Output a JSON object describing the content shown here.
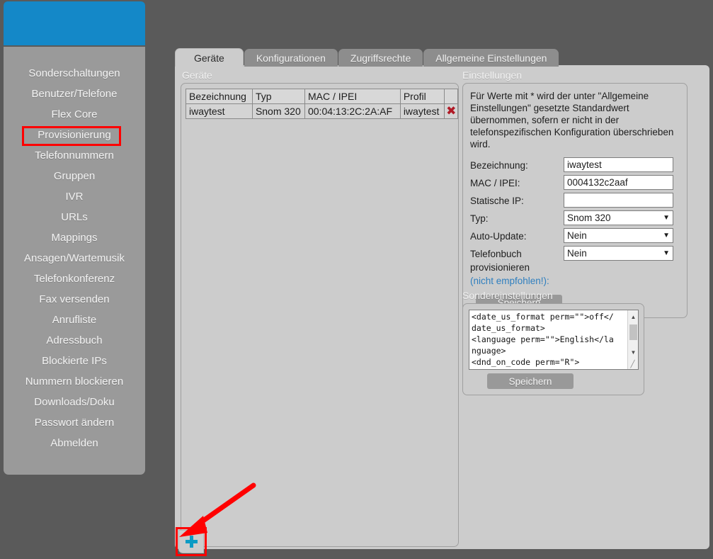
{
  "sidebar": {
    "items": [
      {
        "label": "Sonderschaltungen",
        "highlighted": false
      },
      {
        "label": "Benutzer/Telefone",
        "highlighted": false
      },
      {
        "label": "Flex Core",
        "highlighted": false
      },
      {
        "label": "Provisionierung",
        "highlighted": true
      },
      {
        "label": "Telefonnummern",
        "highlighted": false
      },
      {
        "label": "Gruppen",
        "highlighted": false
      },
      {
        "label": "IVR",
        "highlighted": false
      },
      {
        "label": "URLs",
        "highlighted": false
      },
      {
        "label": "Mappings",
        "highlighted": false
      },
      {
        "label": "Ansagen/Wartemusik",
        "highlighted": false
      },
      {
        "label": "Telefonkonferenz",
        "highlighted": false
      },
      {
        "label": "Fax versenden",
        "highlighted": false
      },
      {
        "label": "Anrufliste",
        "highlighted": false
      },
      {
        "label": "Adressbuch",
        "highlighted": false
      },
      {
        "label": "Blockierte IPs",
        "highlighted": false
      },
      {
        "label": "Nummern blockieren",
        "highlighted": false
      },
      {
        "label": "Downloads/Doku",
        "highlighted": false
      },
      {
        "label": "Passwort ändern",
        "highlighted": false
      },
      {
        "label": "Abmelden",
        "highlighted": false
      }
    ]
  },
  "tabs": [
    {
      "label": "Geräte",
      "active": true
    },
    {
      "label": "Konfigurationen",
      "active": false
    },
    {
      "label": "Zugriffsrechte",
      "active": false
    },
    {
      "label": "Allgemeine Einstellungen",
      "active": false
    }
  ],
  "devices": {
    "legend": "Geräte",
    "columns": [
      "Bezeichnung",
      "Typ",
      "MAC / IPEI",
      "Profil",
      ""
    ],
    "rows": [
      {
        "bezeichnung": "iwaytest",
        "typ": "Snom 320",
        "mac": "00:04:13:2C:2A:AF",
        "profil": "iwaytest",
        "delete_icon": "delete-x-icon"
      }
    ],
    "add_button_icon": "plus-icon"
  },
  "settings": {
    "legend": "Einstellungen",
    "info": "Für Werte mit * wird der unter \"Allgemeine Einstellungen\" gesetzte Standardwert übernommen, sofern er nicht in der telefonspezifischen Konfiguration überschrieben wird.",
    "fields": {
      "bezeichnung_label": "Bezeichnung:",
      "bezeichnung_value": "iwaytest",
      "mac_label": "MAC / IPEI:",
      "mac_value": "0004132c2aaf",
      "static_ip_label": "Statische IP:",
      "static_ip_value": "",
      "typ_label": "Typ:",
      "typ_value": "Snom 320",
      "auto_update_label": "Auto-Update:",
      "auto_update_value": "Nein",
      "phonebook_label": "Telefonbuch provisionieren",
      "phonebook_hint": "(nicht empfohlen!):",
      "phonebook_value": "Nein"
    },
    "save_label": "Speichern"
  },
  "special_settings": {
    "legend": "Sondereinstellungen",
    "textarea_value": "<date_us_format perm=\"\">off</date_us_format>\n<language perm=\"\">English</language>\n<dnd_on_code perm=\"R\">\n</dnd_on_code>",
    "save_label": "Speichern",
    "scroll_up_icon": "caret-up-icon",
    "scroll_down_icon": "caret-down-icon",
    "resize_icon": "resize-handle-icon"
  },
  "annotations": {
    "nav_highlight_color": "#ff0000",
    "arrow_color": "#ff0000",
    "accent_blue": "#1488c8",
    "plus_color": "#0b9bc4",
    "delete_color": "#b01a26"
  }
}
